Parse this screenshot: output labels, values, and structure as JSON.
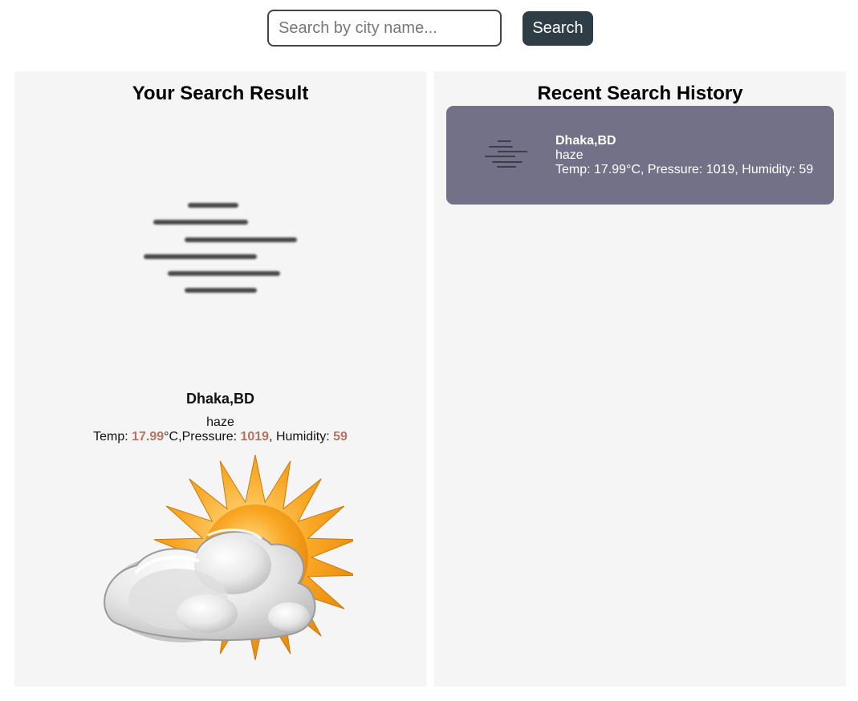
{
  "search": {
    "placeholder": "Search by city name...",
    "button_label": "Search"
  },
  "result_panel": {
    "title": "Your Search Result",
    "weather_icon": "haze-icon",
    "city": "Dhaka,BD",
    "condition": "haze",
    "temp_label": "Temp: ",
    "temp_value": "17.99",
    "temp_unit": "°C,",
    "pressure_label": "Pressure: ",
    "pressure_value": "1019",
    "humidity_label": ", Humidity: ",
    "humidity_value": "59",
    "illustration_icon": "sun-behind-cloud-icon"
  },
  "history_panel": {
    "title": "Recent Search History",
    "items": [
      {
        "icon": "haze-icon",
        "city": "Dhaka,BD",
        "condition": "haze",
        "details": "Temp: 17.99°C, Pressure: 1019, Humidity: 59"
      }
    ]
  },
  "colors": {
    "button_bg": "#2f3e46",
    "panel_bg": "#f5f5f5",
    "history_card_bg": "#737187",
    "stat_value": "#b5735e"
  }
}
